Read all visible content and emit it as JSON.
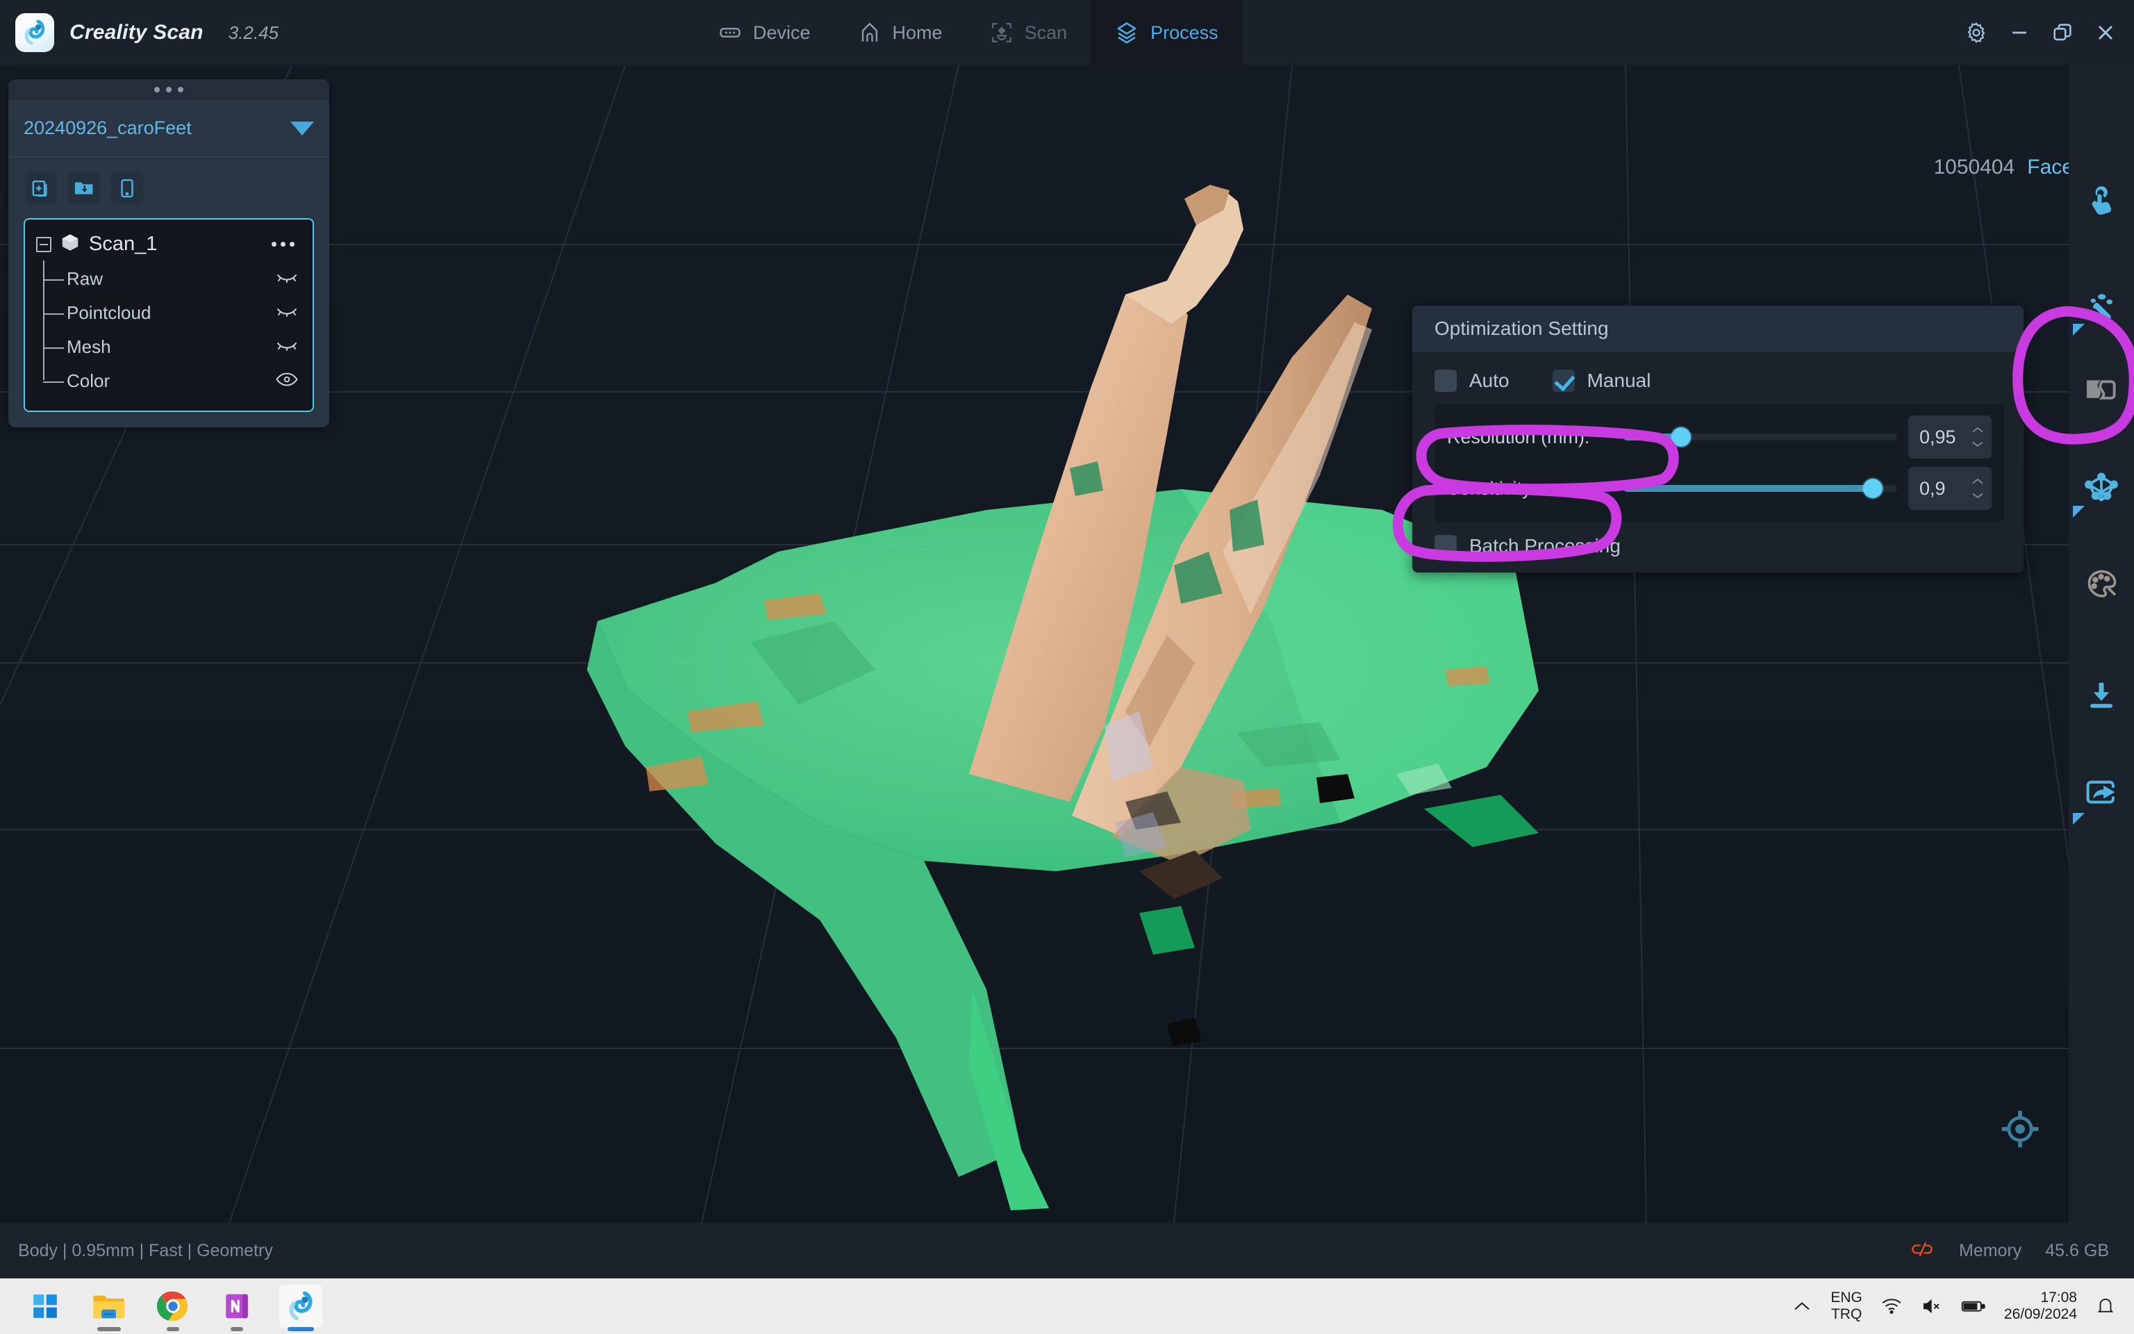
{
  "app": {
    "name": "Creality Scan",
    "version": "3.2.45",
    "logo_icon": "creality-swirl-logo"
  },
  "nav": {
    "tabs": [
      {
        "id": "device",
        "label": "Device",
        "icon": "device-icon",
        "active": false,
        "dim": false
      },
      {
        "id": "home",
        "label": "Home",
        "icon": "home-icon",
        "active": false,
        "dim": false
      },
      {
        "id": "scan",
        "label": "Scan",
        "icon": "scan-icon",
        "active": false,
        "dim": true
      },
      {
        "id": "process",
        "label": "Process",
        "icon": "layers-icon",
        "active": true,
        "dim": false
      }
    ]
  },
  "window_controls": [
    {
      "id": "settings",
      "icon": "gear-icon"
    },
    {
      "id": "minimize",
      "icon": "minimize-icon"
    },
    {
      "id": "restore",
      "icon": "restore-icon"
    },
    {
      "id": "close",
      "icon": "close-icon"
    }
  ],
  "viewport": {
    "faces_count": "1050404",
    "faces_label": "Faces",
    "gizmo_icon": "recenter-target-icon",
    "background_color": "#141a22",
    "grid_color": "#2a3441"
  },
  "left_panel": {
    "drag_handle_icon": "drag-dots-icon",
    "project_name": "20240926_caroFeet",
    "project_dropdown_icon": "caret-down-icon",
    "tools": [
      {
        "id": "new-project",
        "icon": "new-file-icon"
      },
      {
        "id": "import-folder",
        "icon": "folder-import-icon"
      },
      {
        "id": "device-preview",
        "icon": "tablet-icon"
      }
    ],
    "tree": {
      "root": {
        "label": "Scan_1",
        "icon": "cube-icon",
        "expander_icon": "collapse-minus-icon",
        "menu_icon": "kebab-menu-icon",
        "selected": true
      },
      "children": [
        {
          "label": "Raw",
          "visible": false,
          "icon": "eye-closed-icon"
        },
        {
          "label": "Pointcloud",
          "visible": false,
          "icon": "eye-closed-icon"
        },
        {
          "label": "Mesh",
          "visible": false,
          "icon": "eye-closed-icon"
        },
        {
          "label": "Color",
          "visible": true,
          "icon": "eye-open-icon"
        }
      ]
    }
  },
  "optimization_panel": {
    "title": "Optimization Setting",
    "mode_options": [
      {
        "id": "auto",
        "label": "Auto",
        "checked": false
      },
      {
        "id": "manual",
        "label": "Manual",
        "checked": true
      }
    ],
    "sliders": [
      {
        "id": "resolution",
        "label": "Resolution (mm):",
        "value": "0,95",
        "fill_percent": 21,
        "annotated": true
      },
      {
        "id": "sensitivity",
        "label": "Sensitivity:",
        "value": "0,9",
        "fill_percent": 91,
        "annotated": true
      }
    ],
    "spinner_icons": {
      "up": "chevron-up-icon",
      "down": "chevron-down-icon"
    },
    "batch": {
      "id": "batch-processing",
      "label": "Batch Processing",
      "checked": false
    }
  },
  "right_toolbar": {
    "items": [
      {
        "id": "manual-edit",
        "icon": "hand-tap-icon",
        "enabled": true,
        "has_submenu": false,
        "annotated": true
      },
      {
        "id": "denoise",
        "icon": "sparkle-dots-icon",
        "enabled": true,
        "has_submenu": true,
        "annotated": false
      },
      {
        "id": "fill-holes",
        "icon": "patch-fill-icon",
        "enabled": false,
        "has_submenu": false,
        "annotated": false
      },
      {
        "id": "simplify-mesh",
        "icon": "mesh-nodes-icon",
        "enabled": true,
        "has_submenu": true,
        "annotated": false
      },
      {
        "id": "texture",
        "icon": "palette-icon",
        "enabled": false,
        "has_submenu": false,
        "annotated": false
      },
      {
        "id": "save",
        "icon": "download-icon",
        "enabled": true,
        "has_submenu": false,
        "annotated": false
      },
      {
        "id": "export-share",
        "icon": "share-export-icon",
        "enabled": true,
        "has_submenu": true,
        "annotated": false
      }
    ]
  },
  "annotations": {
    "color": "#c93ae0",
    "marks": [
      {
        "id": "anno-right-tool",
        "target": "manual-edit-tool",
        "shape": "ellipse"
      },
      {
        "id": "anno-resolution",
        "target": "resolution-label",
        "shape": "ellipse"
      },
      {
        "id": "anno-sensitivity",
        "target": "sensitivity-label",
        "shape": "ellipse"
      }
    ]
  },
  "status_bar": {
    "left_text": "Body | 0.95mm | Fast | Geometry",
    "link_icon": "broken-link-icon",
    "memory_label": "Memory",
    "memory_value": "45.6 GB"
  },
  "taskbar": {
    "apps": [
      {
        "id": "start",
        "icon": "windows-start-icon",
        "running": false,
        "active": false
      },
      {
        "id": "file-explorer",
        "icon": "folder-icon",
        "running": true,
        "active": false
      },
      {
        "id": "chrome",
        "icon": "chrome-icon",
        "running": true,
        "active": false
      },
      {
        "id": "onenote",
        "icon": "onenote-icon",
        "running": true,
        "active": false
      },
      {
        "id": "creality-scan",
        "icon": "creality-icon",
        "running": true,
        "active": true
      }
    ],
    "tray": {
      "expand_icon": "chevron-up-icon",
      "language_primary": "ENG",
      "language_secondary": "TRQ",
      "wifi_icon": "wifi-icon",
      "volume_icon": "volume-muted-icon",
      "battery_icon": "battery-icon",
      "time": "17:08",
      "date": "26/09/2024",
      "notification_icon": "bell-icon"
    }
  }
}
